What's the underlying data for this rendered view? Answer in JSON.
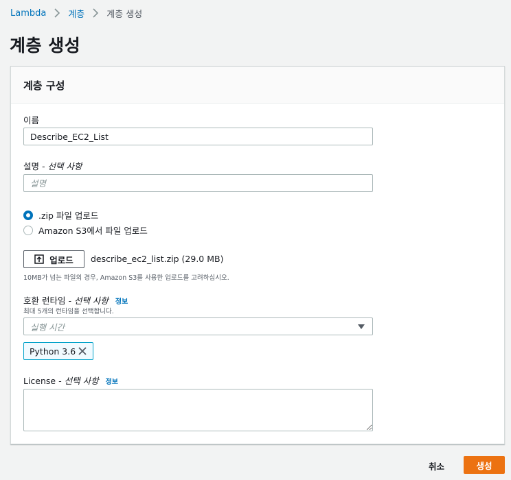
{
  "breadcrumb": {
    "items": [
      {
        "label": "Lambda"
      },
      {
        "label": "계층"
      }
    ],
    "current": "계층 생성"
  },
  "page": {
    "title": "계층 생성"
  },
  "panel": {
    "title": "계층 구성"
  },
  "name_field": {
    "label": "이름",
    "value": "Describe_EC2_List"
  },
  "description_field": {
    "label": "설명",
    "optional": "선택 사항",
    "placeholder": "설명"
  },
  "upload_source": {
    "options": [
      {
        "label": ".zip 파일 업로드",
        "checked": true
      },
      {
        "label": "Amazon S3에서 파일 업로드",
        "checked": false
      }
    ]
  },
  "upload": {
    "button_label": "업로드",
    "file_name": "describe_ec2_list.zip (29.0 MB)",
    "hint": "10MB가 넘는 파일의 경우, Amazon S3를 사용한 업로드를 고려하십시오."
  },
  "runtimes": {
    "label": "호환 런타임",
    "optional": "선택 사항",
    "info": "정보",
    "hint": "최대 5개의 런타임을 선택합니다.",
    "placeholder": "실행 시간",
    "selected": [
      "Python 3.6"
    ]
  },
  "license": {
    "label": "License",
    "optional": "선택 사항",
    "info": "정보"
  },
  "footer": {
    "cancel_label": "취소",
    "create_label": "생성"
  },
  "colors": {
    "link": "#0073bb",
    "primary_button": "#ec7211",
    "token_border": "#00a1c9",
    "background": "#f2f3f3"
  }
}
